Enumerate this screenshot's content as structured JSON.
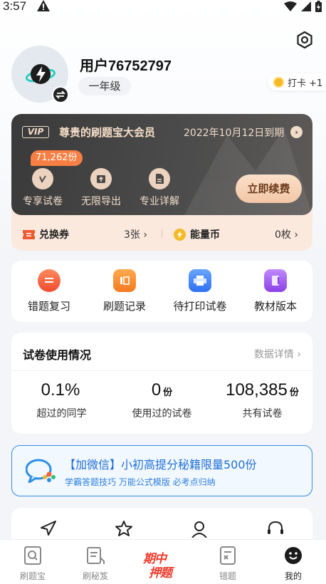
{
  "status_bar": {
    "time": "3:57"
  },
  "profile": {
    "username": "用户76752797",
    "grade": "一年级",
    "checkin_label": "打卡 +1"
  },
  "vip": {
    "badge": "VIP",
    "title": "尊贵的刷题宝大会员",
    "expire": "2022年10月12日到期",
    "count_badge": "71,262份",
    "perks": [
      {
        "label": "专享试卷",
        "icon": "paper-icon"
      },
      {
        "label": "无限导出",
        "icon": "export-icon"
      },
      {
        "label": "专业详解",
        "icon": "doc-icon"
      }
    ],
    "renew_label": "立即续费",
    "voucher_label": "兑换券",
    "voucher_value": "3张",
    "energy_label": "能量币",
    "energy_value": "0枚"
  },
  "quick_actions": [
    {
      "label": "错题复习",
      "icon": "review-icon",
      "color": "#f5643c"
    },
    {
      "label": "刷题记录",
      "icon": "record-icon",
      "color": "#f7872e"
    },
    {
      "label": "待打印试卷",
      "icon": "printer-icon",
      "color": "#3d7ff2"
    },
    {
      "label": "教材版本",
      "icon": "book-icon",
      "color": "#9b54e8"
    }
  ],
  "usage": {
    "title": "试卷使用情况",
    "more": "数据详情",
    "stats": [
      {
        "value": "0.1%",
        "unit": "",
        "label": "超过的同学"
      },
      {
        "value": "0",
        "unit": "份",
        "label": "使用过的试卷"
      },
      {
        "value": "108,385",
        "unit": "份",
        "label": "共有试卷"
      }
    ]
  },
  "promo": {
    "title": "【加微信】小初高提分秘籍限量500份",
    "subtitle": "学霸答题技巧 万能公式模版 必考点归纳"
  },
  "bottom_icons": [
    "send-icon",
    "star-icon",
    "person-icon",
    "headset-icon"
  ],
  "tabs": [
    {
      "label": "刷题宝",
      "icon": "search-doc-icon"
    },
    {
      "label": "刷秘笈",
      "icon": "notebook-icon"
    },
    {
      "label": "期中押题",
      "icon": "exam-promo-icon"
    },
    {
      "label": "错题",
      "icon": "wrong-book-icon"
    },
    {
      "label": "我的",
      "icon": "smile-icon"
    }
  ],
  "colors": {
    "accent": "#2d8fe8",
    "vip_dark": "#3a3a3a",
    "orange": "#f77f43"
  }
}
